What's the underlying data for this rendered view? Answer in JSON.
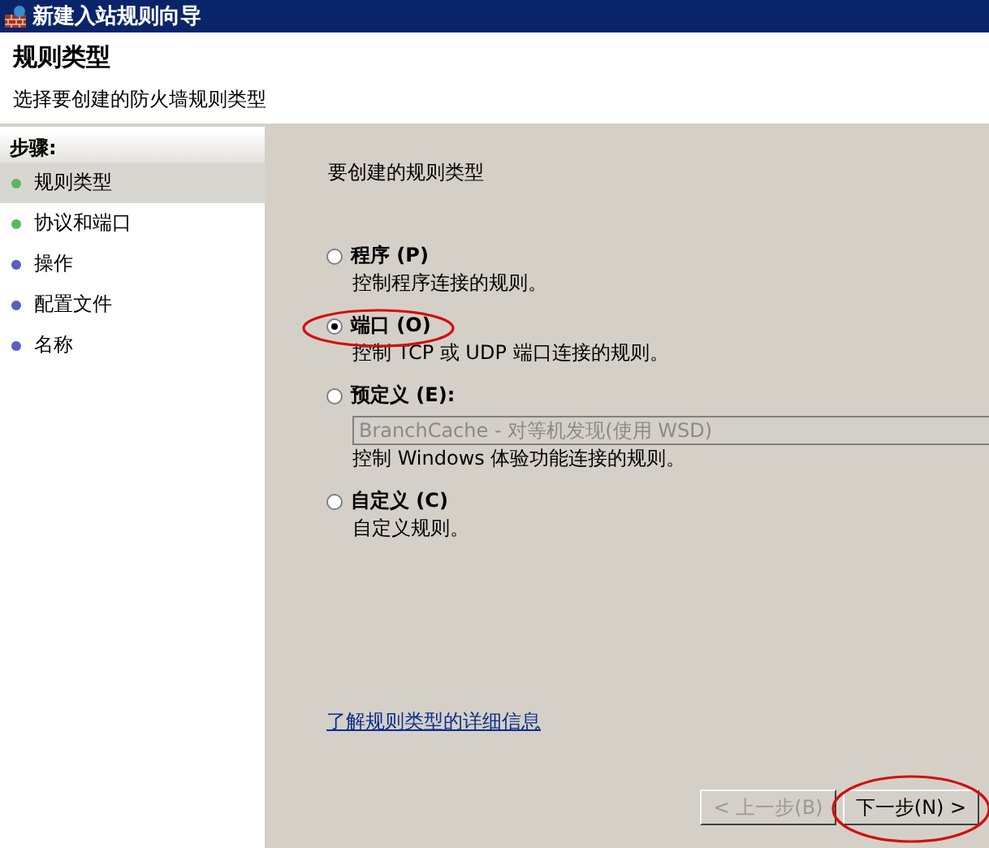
{
  "window": {
    "title": "新建入站规则向导"
  },
  "header": {
    "title": "规则类型",
    "subtitle": "选择要创建的防火墙规则类型"
  },
  "steps": {
    "heading": "步骤:",
    "items": [
      {
        "label": "规则类型",
        "color": "#5cb85c",
        "selected": true
      },
      {
        "label": "协议和端口",
        "color": "#5cb85c",
        "selected": false
      },
      {
        "label": "操作",
        "color": "#5a5fc0",
        "selected": false
      },
      {
        "label": "配置文件",
        "color": "#5a5fc0",
        "selected": false
      },
      {
        "label": "名称",
        "color": "#5a5fc0",
        "selected": false
      }
    ]
  },
  "content": {
    "prompt": "要创建的规则类型",
    "options": [
      {
        "label": "程序 (P)",
        "description": "控制程序连接的规则。",
        "selected": false,
        "highlighted": false
      },
      {
        "label": "端口 (O)",
        "description": "控制 TCP 或 UDP 端口连接的规则。",
        "selected": true,
        "highlighted": true
      },
      {
        "label": "预定义 (E):",
        "dropdown": {
          "value": "BranchCache - 对等机发现(使用 WSD)",
          "disabled": true
        },
        "description": "控制 Windows 体验功能连接的规则。",
        "selected": false,
        "highlighted": false
      },
      {
        "label": "自定义 (C)",
        "description": "自定义规则。",
        "selected": false,
        "highlighted": false
      }
    ],
    "link": "了解规则类型的详细信息"
  },
  "buttons": [
    {
      "label": "< 上一步(B)",
      "disabled": true,
      "highlighted": false
    },
    {
      "label": "下一步(N) >",
      "disabled": false,
      "highlighted": true
    }
  ]
}
